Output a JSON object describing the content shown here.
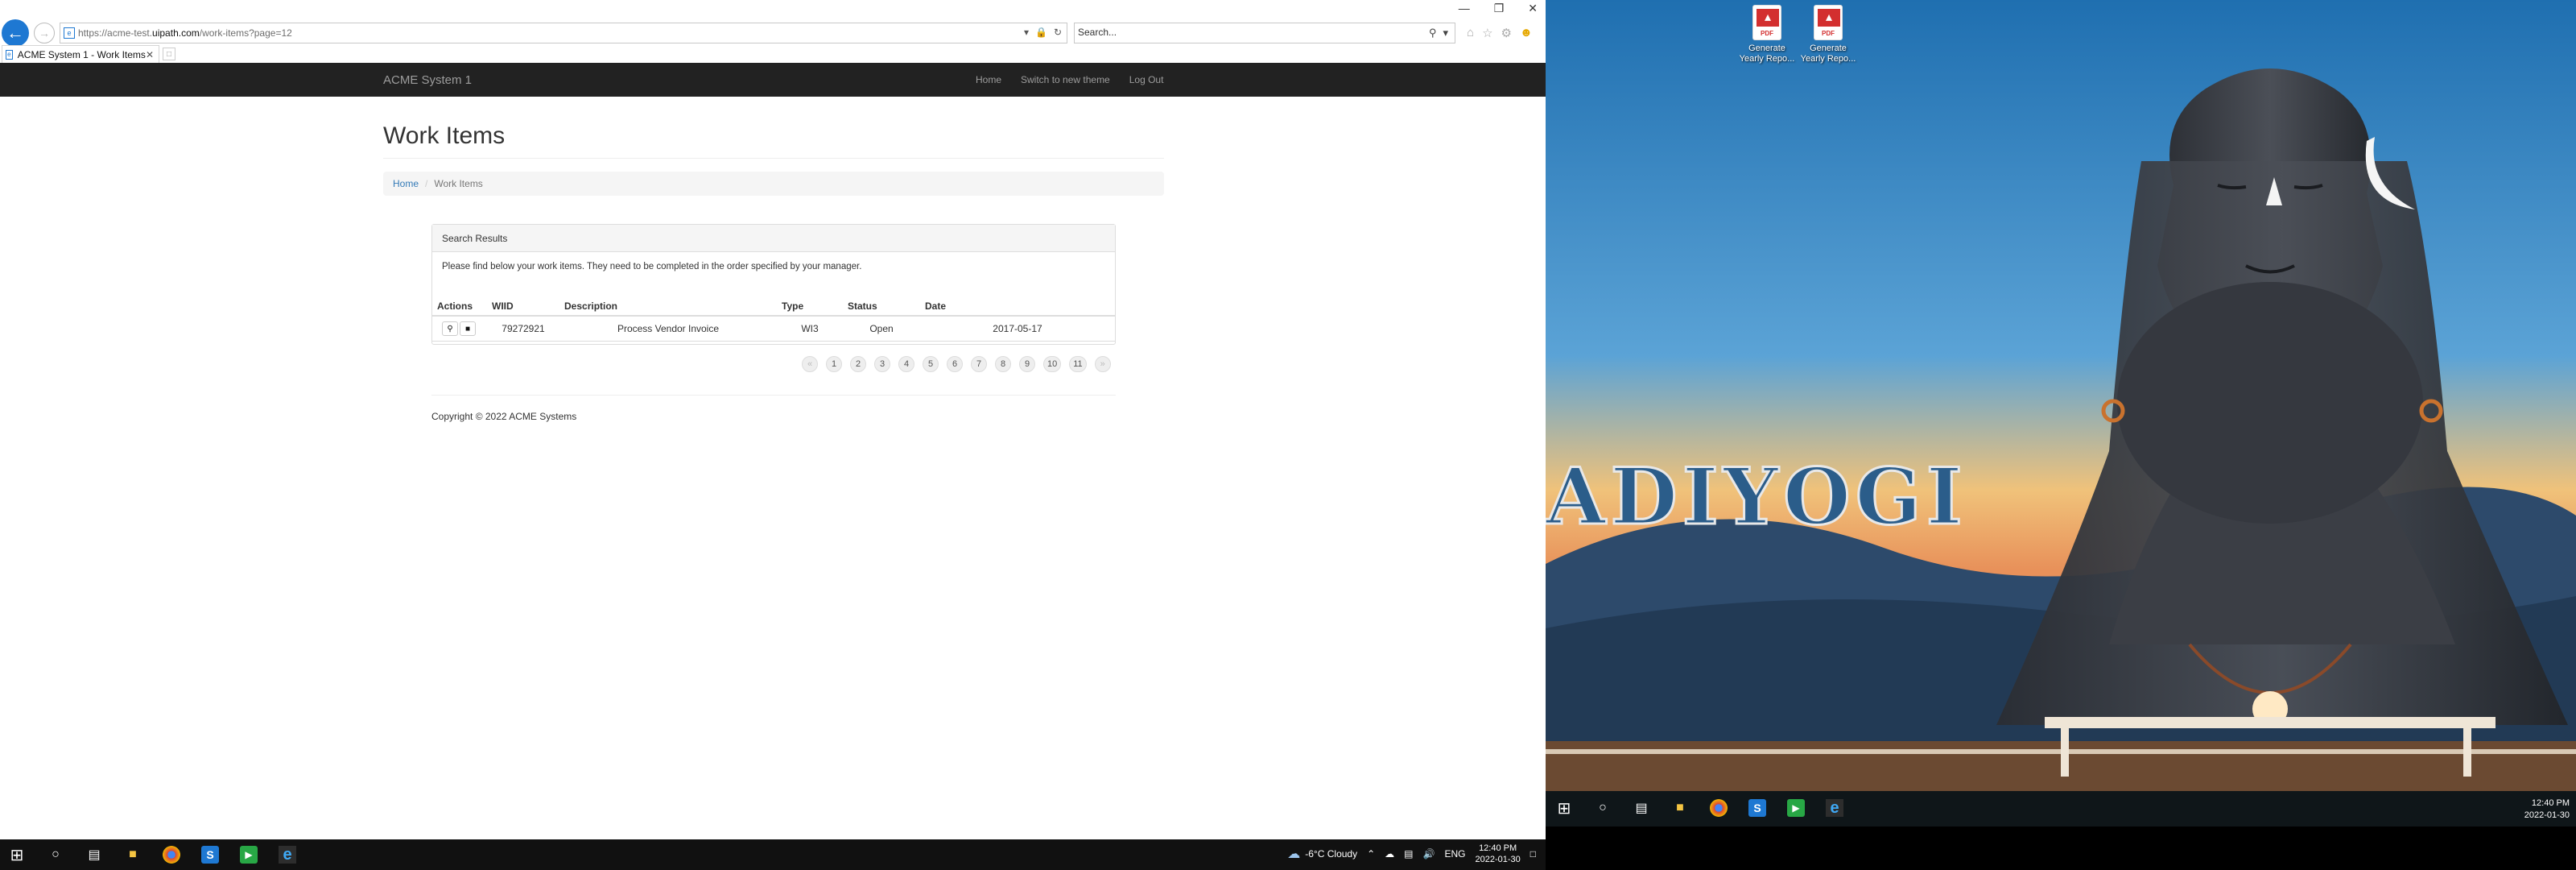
{
  "browser": {
    "url_prefix": "https://acme-test.",
    "url_domain": "uipath.com",
    "url_suffix": "/work-items?page=12",
    "search_placeholder": "Search...",
    "tab_title": "ACME System 1 - Work Items"
  },
  "site": {
    "brand": "ACME System 1",
    "nav": [
      "Home",
      "Switch to new theme",
      "Log Out"
    ]
  },
  "page": {
    "title": "Work Items",
    "breadcrumb": [
      "Home",
      "Work Items"
    ],
    "panel_heading": "Search Results",
    "panel_body": "Please find below your work items. They need to be completed in the order specified by your manager.",
    "table": {
      "headers": [
        "Actions",
        "WIID",
        "Description",
        "Type",
        "Status",
        "Date"
      ],
      "rows": [
        {
          "wiid": "79272921",
          "description": "Process Vendor Invoice",
          "type": "WI3",
          "status": "Open",
          "date": "2017-05-17"
        }
      ]
    },
    "pagination": [
      "«",
      "1",
      "2",
      "3",
      "4",
      "5",
      "6",
      "7",
      "8",
      "9",
      "10",
      "11",
      "»"
    ],
    "footer": "Copyright © 2022 ACME Systems"
  },
  "taskbar_left": {
    "weather": "-6°C  Cloudy",
    "lang": "ENG",
    "time": "12:40 PM",
    "date": "2022-01-30"
  },
  "desktop": {
    "icons": [
      {
        "label": "Generate Yearly Repo...",
        "badge": "PDF"
      },
      {
        "label": "Generate Yearly Repo...",
        "badge": "PDF"
      }
    ],
    "wallpaper_text": "ADIYOGI",
    "time": "12:40 PM",
    "date": "2022-01-30"
  }
}
